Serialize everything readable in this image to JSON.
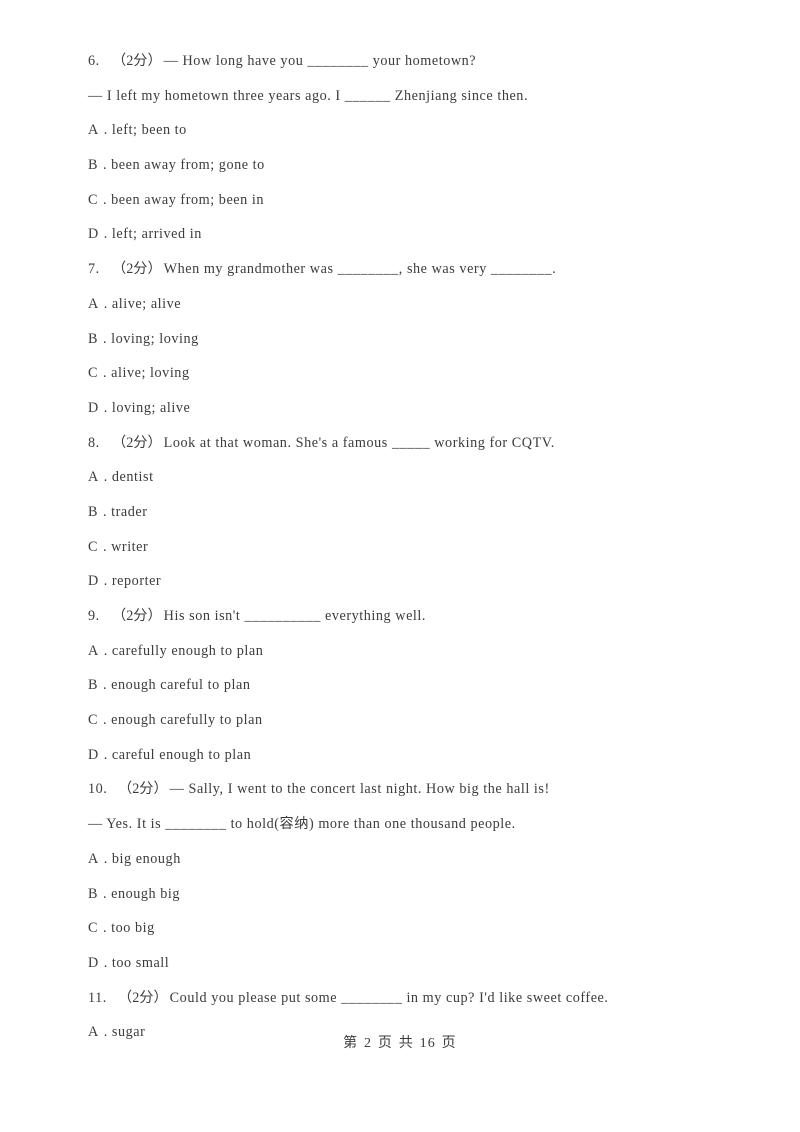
{
  "document": {
    "type": "exam-worksheet",
    "background_color": "#ffffff",
    "text_color": "#3c3c3c"
  },
  "footer": {
    "prefix": "第",
    "page_number": "2",
    "middle": "页 共",
    "total_pages": "16",
    "suffix": "页",
    "full_text": "第 2 页 共 16 页"
  },
  "questions": [
    {
      "number": "6.",
      "score": "（2分）",
      "stem": "— How long have you ________ your hometown?",
      "continuation": "— I left my hometown three years ago. I ______ Zhenjiang since then.",
      "options": [
        {
          "letter": "A",
          "dot": ".",
          "text": "left; been to"
        },
        {
          "letter": "B",
          "dot": ".",
          "text": "been away from; gone to"
        },
        {
          "letter": "C",
          "dot": ".",
          "text": "been away from; been in"
        },
        {
          "letter": "D",
          "dot": ".",
          "text": "left; arrived in"
        }
      ]
    },
    {
      "number": "7.",
      "score": "（2分）",
      "stem": "When my grandmother was ________, she was very ________.",
      "continuation": "",
      "options": [
        {
          "letter": "A",
          "dot": ".",
          "text": "alive; alive"
        },
        {
          "letter": "B",
          "dot": ".",
          "text": "loving; loving"
        },
        {
          "letter": "C",
          "dot": ".",
          "text": "alive; loving"
        },
        {
          "letter": "D",
          "dot": ".",
          "text": "loving; alive"
        }
      ]
    },
    {
      "number": "8.",
      "score": "（2分）",
      "stem": "Look at that woman. She's a famous _____ working for CQTV.",
      "continuation": "",
      "options": [
        {
          "letter": "A",
          "dot": ".",
          "text": "dentist"
        },
        {
          "letter": "B",
          "dot": ".",
          "text": "trader"
        },
        {
          "letter": "C",
          "dot": ".",
          "text": "writer"
        },
        {
          "letter": "D",
          "dot": ".",
          "text": "reporter"
        }
      ]
    },
    {
      "number": "9.",
      "score": "（2分）",
      "stem": "His son isn't __________ everything well.",
      "continuation": "",
      "options": [
        {
          "letter": "A",
          "dot": ".",
          "text": "carefully enough to plan"
        },
        {
          "letter": "B",
          "dot": ".",
          "text": "enough careful to plan"
        },
        {
          "letter": "C",
          "dot": ".",
          "text": "enough carefully to plan"
        },
        {
          "letter": "D",
          "dot": ".",
          "text": "careful enough to plan"
        }
      ]
    },
    {
      "number": "10.",
      "score": "（2分）",
      "stem": "— Sally, I went to the concert last night. How big the hall is!",
      "continuation": "— Yes. It is ________ to hold(容纳) more than one thousand people.",
      "options": [
        {
          "letter": "A",
          "dot": ".",
          "text": "big enough"
        },
        {
          "letter": "B",
          "dot": ".",
          "text": "enough big"
        },
        {
          "letter": "C",
          "dot": ".",
          "text": "too big"
        },
        {
          "letter": "D",
          "dot": ".",
          "text": "too small"
        }
      ]
    },
    {
      "number": "11.",
      "score": "（2分）",
      "stem": "Could you please put some ________ in my cup? I'd like sweet coffee.",
      "continuation": "",
      "options": [
        {
          "letter": "A",
          "dot": ".",
          "text": "sugar"
        }
      ]
    }
  ]
}
